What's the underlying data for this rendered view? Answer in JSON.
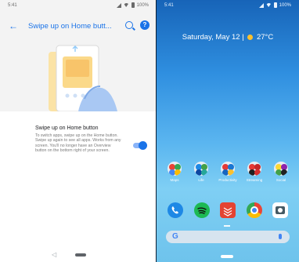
{
  "left_phone": {
    "status_time": "5:41",
    "status_battery": "100%",
    "app_title": "Swipe up on Home butt...",
    "setting_title": "Swipe up on Home button",
    "setting_description": "To switch apps, swipe up on the Home button. Swipe up again to see all apps. Works from any screen. You'll no longer have an Overview button on the bottom right of your screen.",
    "toggle_on": true,
    "icons": [
      "back-arrow-icon",
      "search-icon",
      "help-icon",
      "signal-icon",
      "wifi-icon",
      "battery-icon"
    ],
    "accent_color": "#1a73e8"
  },
  "right_phone": {
    "status_time": "5:41",
    "status_battery": "100%",
    "date_text": "Saturday, May 12",
    "weather_text": "27°C",
    "app_folders": [
      {
        "label": "Maps"
      },
      {
        "label": "Life"
      },
      {
        "label": "Productivity"
      },
      {
        "label": "Streaming"
      },
      {
        "label": "Social"
      }
    ],
    "dock_apps": [
      "phone-icon",
      "spotify-icon",
      "todoist-icon",
      "chrome-icon",
      "camera-icon"
    ],
    "search_bar_g": "G"
  }
}
